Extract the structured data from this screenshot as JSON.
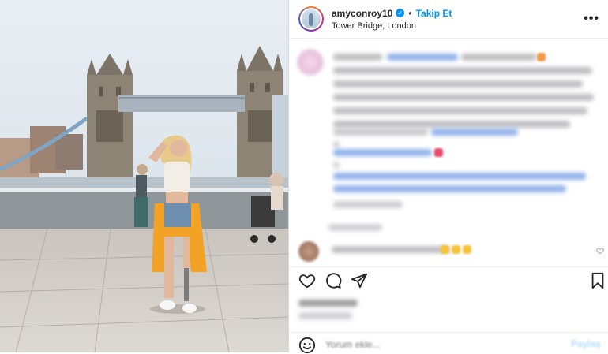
{
  "post": {
    "username": "amyconroy10",
    "separator": "•",
    "follow_label": "Takip Et",
    "location": "Tower Bridge, London",
    "more_label": "•••",
    "comment_placeholder": "Yorum ekle...",
    "share_label": "Paylaş"
  },
  "icons": {
    "verified": "verified-check-icon",
    "more": "more-options-icon",
    "like": "heart-icon",
    "comment": "comment-bubble-icon",
    "share": "share-paper-plane-icon",
    "save": "bookmark-icon",
    "emoji": "emoji-icon",
    "comment_like": "heart-small-icon"
  },
  "colors": {
    "accent": "#0095f6",
    "text": "#262626",
    "border": "#dbdbdb",
    "jacket": "#f2a224",
    "sky": "#dfe8ef"
  }
}
